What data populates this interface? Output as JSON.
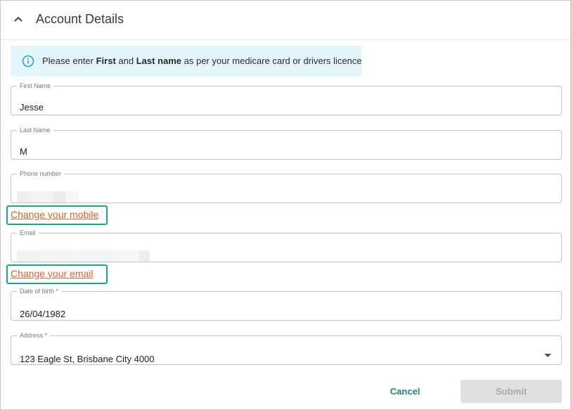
{
  "header": {
    "title": "Account Details",
    "collapse_icon": "chevron-up-icon"
  },
  "info": {
    "icon": "info-icon",
    "prefix": "Please enter ",
    "bold1": "First",
    "mid": " and ",
    "bold2": "Last name",
    "suffix": " as per your medicare card or drivers licence",
    "background": "#e5f5fc",
    "icon_color": "#29a3d8"
  },
  "form": {
    "first_name": {
      "label": "First Name",
      "value": "Jesse"
    },
    "last_name": {
      "label": "Last Name",
      "value": "M"
    },
    "phone": {
      "label": "Phone number",
      "value_redacted": true
    },
    "change_mobile": "Change your mobile",
    "email": {
      "label": "Email",
      "value_redacted": true
    },
    "change_email": "Change your email",
    "dob": {
      "label": "Date of birth *",
      "value": "26/04/1982"
    },
    "address": {
      "label": "Address *",
      "value": "123 Eagle St, Brisbane City 4000",
      "icon": "dropdown-arrow-icon"
    }
  },
  "actions": {
    "cancel": "Cancel",
    "submit": "Submit",
    "submit_disabled": true
  },
  "colors": {
    "link": "#e0622a",
    "highlight_border": "#1aa88a",
    "cancel": "#1b8a73"
  }
}
